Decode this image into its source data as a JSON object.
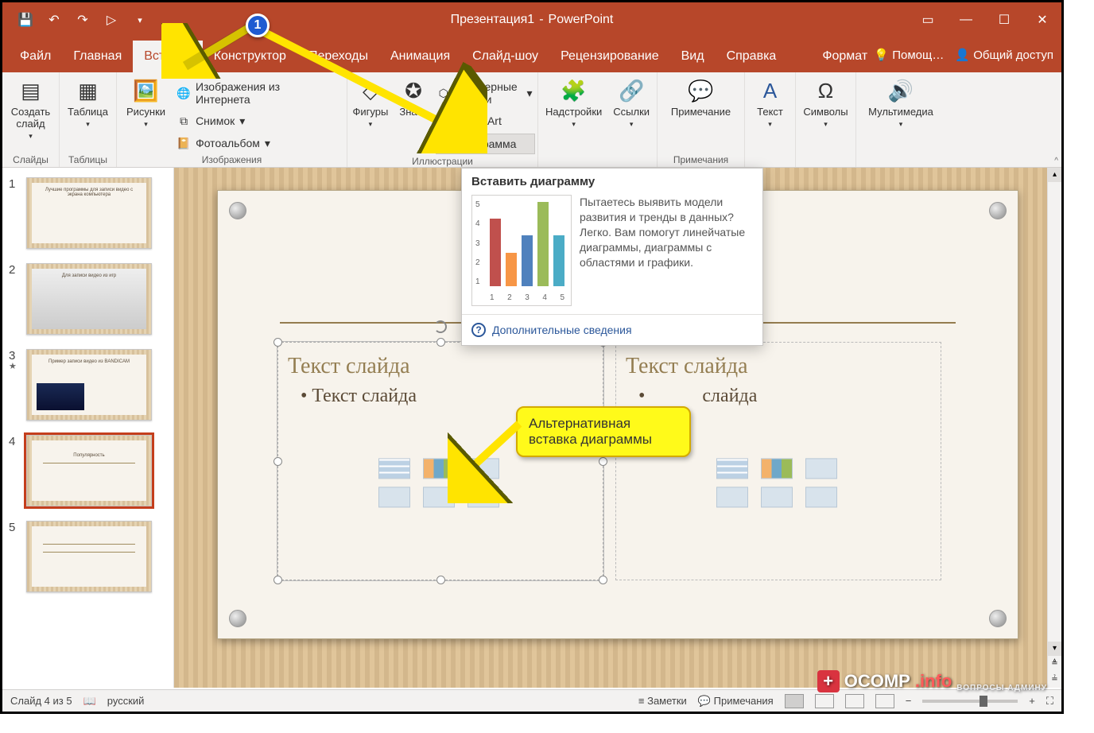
{
  "app": {
    "title": "Презентация1",
    "app_name": "PowerPoint"
  },
  "window_controls": {
    "min": "—",
    "max": "☐",
    "close": "✕"
  },
  "tabs": {
    "file": "Файл",
    "home": "Главная",
    "insert": "Вставка",
    "design": "Конструктор",
    "transitions": "Переходы",
    "animations": "Анимация",
    "slideshow": "Слайд-шоу",
    "review": "Рецензирование",
    "view": "Вид",
    "help": "Справка",
    "format": "Формат"
  },
  "right_cmds": {
    "tell": "Помощ…",
    "share": "Общий доступ"
  },
  "ribbon": {
    "slides_group": "Слайды",
    "slides_new": "Создать\nслайд",
    "tables_group": "Таблицы",
    "table": "Таблица",
    "images_group": "Изображения",
    "pictures": "Рисунки",
    "online_pics": "Изображения из Интернета",
    "screenshot": "Снимок",
    "album": "Фотоальбом",
    "illust_group": "Иллюстрации",
    "shapes": "Фигуры",
    "icons": "Зна…",
    "models": "Трехмерные модели",
    "smartart": "SmartArt",
    "chart": "Диаграмма",
    "addins_group": "",
    "addins": "Надстройки",
    "links": "Ссылки",
    "comments_group": "Примечания",
    "comment": "Примечание",
    "text": "Текст",
    "symbols": "Символы",
    "media": "Мультимедиа"
  },
  "tooltip": {
    "title": "Вставить диаграмму",
    "body": "Пытаетесь выявить модели развития и тренды в данных? Легко. Вам помогут линейчатые диаграммы, диаграммы с областями и графики.",
    "more": "Дополнительные сведения"
  },
  "callout": {
    "line1": "Альтернативная",
    "line2": "вставка диаграммы"
  },
  "step": "1",
  "thumbs": {
    "t1": "Лучшие программы для записи видео с экрана компьютера",
    "t2": "Для записи видео из игр",
    "t3": "Пример записи видео из BANDICAM",
    "t4": "Популярность"
  },
  "slide_placeholders": {
    "title": "Текст слайда",
    "bullet": "Текст слайда"
  },
  "statusbar": {
    "slide": "Слайд 4 из 5",
    "lang": "русский",
    "notes": "Заметки",
    "comments": "Примечания"
  },
  "watermark": {
    "brand": "OCOMP",
    "tld": ".info",
    "sub": "ВОПРОСЫ АДМИНУ"
  },
  "chart_data": {
    "type": "bar",
    "categories": [
      "1",
      "2",
      "3",
      "4",
      "5"
    ],
    "values": [
      4,
      2,
      3,
      5,
      3
    ],
    "ylim": [
      0,
      5
    ],
    "colors": [
      "#c0504d",
      "#f79646",
      "#4f81bd",
      "#9bbb59",
      "#4bacc6"
    ]
  }
}
